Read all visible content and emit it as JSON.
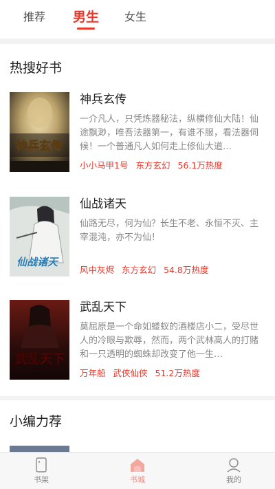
{
  "top_tabs": [
    {
      "label": "推荐",
      "active": false
    },
    {
      "label": "男生",
      "active": true
    },
    {
      "label": "女生",
      "active": false
    }
  ],
  "hot_section": {
    "title": "热搜好书",
    "books": [
      {
        "title": "神兵玄传",
        "description": "一介凡人，只凭炼器秘法，纵横修仙大陆！仙途飘渺，唯吾法器第一，有谁不服，看法器伺候！一个普通凡人如何走上修仙大道…",
        "author": "小小马甲1号",
        "category": "东方玄幻",
        "heat": "56.1万热度",
        "cover_text": "神兵玄传"
      },
      {
        "title": "仙战诸天",
        "description": "仙路无尽，何为仙？长生不老、永恒不灭、主宰混沌，亦不为仙！",
        "author": "风中灰烬",
        "category": "东方玄幻",
        "heat": "54.8万热度",
        "cover_text": "仙战诸天"
      },
      {
        "title": "武乱天下",
        "description": "莫屈原是一个命如蝼蚁的酒楼店小二，受尽世人的冷眼与欺辱，然而，两个武林高人的打赌和一只透明的蜘蛛却改变了他一生…",
        "author": "万年船",
        "category": "武侠仙侠",
        "heat": "51.2万热度",
        "cover_text": "武乱天下"
      }
    ]
  },
  "rec_section": {
    "title": "小编力荐"
  },
  "bottom_nav": [
    {
      "label": "书架",
      "icon": "bookshelf-icon",
      "active": false
    },
    {
      "label": "书城",
      "icon": "bookstore-icon",
      "active": true
    },
    {
      "label": "我的",
      "icon": "profile-icon",
      "active": false
    }
  ],
  "colors": {
    "accent": "#e8392d",
    "nav_active": "#f08a7c",
    "muted": "#888888"
  }
}
